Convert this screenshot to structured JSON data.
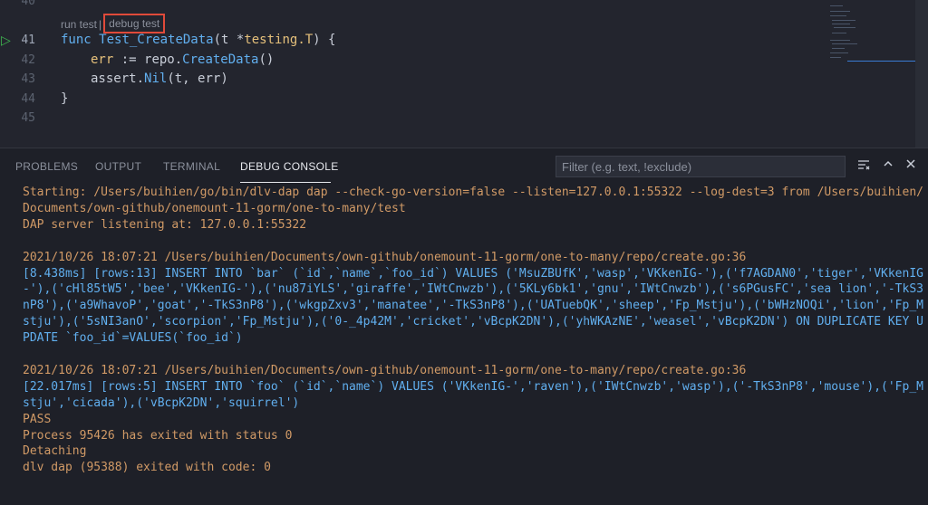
{
  "editor": {
    "line_numbers": [
      "40",
      "41",
      "42",
      "43",
      "44",
      "45"
    ],
    "codelens": {
      "run": "run test",
      "separator": "|",
      "debug": "debug test"
    },
    "code": {
      "l41_kw": "func",
      "l41_fn": "Test_CreateData",
      "l41_args_pre": "(t *",
      "l41_type": "testing.T",
      "l41_args_post": ") {",
      "l42_var": "err",
      "l42_op": " := repo.",
      "l42_fn": "CreateData",
      "l42_end": "()",
      "l43_pre": "assert.",
      "l43_fn": "Nil",
      "l43_end": "(t, err)",
      "l44": "}"
    }
  },
  "panel": {
    "tabs": [
      "PROBLEMS",
      "OUTPUT",
      "TERMINAL",
      "DEBUG CONSOLE"
    ],
    "active_tab": "DEBUG CONSOLE",
    "filter_placeholder": "Filter (e.g. text, !exclude)",
    "controls": {
      "clear_icon": "list-filter-icon",
      "collapse_icon": "chevron-up-icon",
      "close_icon": "close-icon"
    }
  },
  "console": {
    "lines": [
      "Starting: /Users/buihien/go/bin/dlv-dap dap --check-go-version=false --listen=127.0.0.1:55322 --log-dest=3 from /Users/buihien/",
      "Documents/own-github/onemount-11-gorm/one-to-many/test",
      "DAP server listening at: 127.0.0.1:55322",
      "",
      "2021/10/26 18:07:21 /Users/buihien/Documents/own-github/onemount-11-gorm/one-to-many/repo/create.go:36",
      "[8.438ms] [rows:13] INSERT INTO `bar` (`id`,`name`,`foo_id`) VALUES ('MsuZBUfK','wasp','VKkenIG-'),('f7AGDAN0','tiger','VKkenIG",
      "-'),('cHl85tW5','bee','VKkenIG-'),('nu87iYLS','giraffe','IWtCnwzb'),('5KLy6bk1','gnu','IWtCnwzb'),('s6PGusFC','sea lion','-TkS3",
      "nP8'),('a9WhavoP','goat','-TkS3nP8'),('wkgpZxv3','manatee','-TkS3nP8'),('UATuebQK','sheep','Fp_Mstju'),('bWHzNOQi','lion','Fp_M",
      "stju'),('5sNI3anO','scorpion','Fp_Mstju'),('0-_4p42M','cricket','vBcpK2DN'),('yhWKAzNE','weasel','vBcpK2DN') ON DUPLICATE KEY U",
      "PDATE `foo_id`=VALUES(`foo_id`)",
      "",
      "2021/10/26 18:07:21 /Users/buihien/Documents/own-github/onemount-11-gorm/one-to-many/repo/create.go:36",
      "[22.017ms] [rows:5] INSERT INTO `foo` (`id`,`name`) VALUES ('VKkenIG-','raven'),('IWtCnwzb','wasp'),('-TkS3nP8','mouse'),('Fp_M",
      "stju','cicada'),('vBcpK2DN','squirrel')",
      "PASS",
      "Process 95426 has exited with status 0",
      "Detaching",
      "dlv dap (95388) exited with code: 0"
    ],
    "blue_lines": [
      5,
      6,
      7,
      8,
      9,
      12,
      13
    ],
    "colors": {
      "orange": "#d19a66",
      "blue": "#61afef"
    }
  }
}
